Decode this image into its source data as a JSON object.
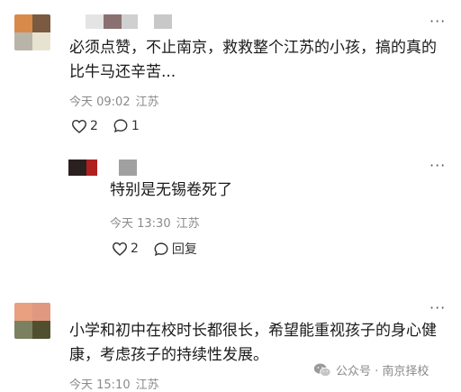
{
  "comments": [
    {
      "text": "必须点赞，不止南京，救救整个江苏的小孩，搞的真的比牛马还辛苦...",
      "time": "今天 09:02",
      "location": "江苏",
      "likes": "2",
      "replies": "1",
      "avatar_colors": [
        "#d88a4a",
        "#7a5a40",
        "#b8b5a8",
        "#e8e3d0"
      ],
      "name_colors": [
        "#e4e4e4",
        "#8a7070",
        "#d0d0d0",
        "#c8c8c8"
      ]
    },
    {
      "text": "特别是无锡卷死了",
      "time": "今天 13:30",
      "location": "江苏",
      "likes": "2",
      "reply_label": "回复",
      "avatar_colors": [
        "#2a2020",
        "#b02020",
        "#a0a0a0"
      ]
    },
    {
      "text": "小学和初中在校时长都很长，希望能重视孩子的身心健康，考虑孩子的持续性发展。",
      "time": "今天 15:10",
      "location": "江苏",
      "avatar_colors": [
        "#e8a080",
        "#e09880",
        "#7a8060",
        "#505030"
      ]
    }
  ],
  "watermark": "公众号 · 南京择校",
  "icons": [
    "heart-icon",
    "comment-icon",
    "more-icon",
    "wechat-icon"
  ]
}
